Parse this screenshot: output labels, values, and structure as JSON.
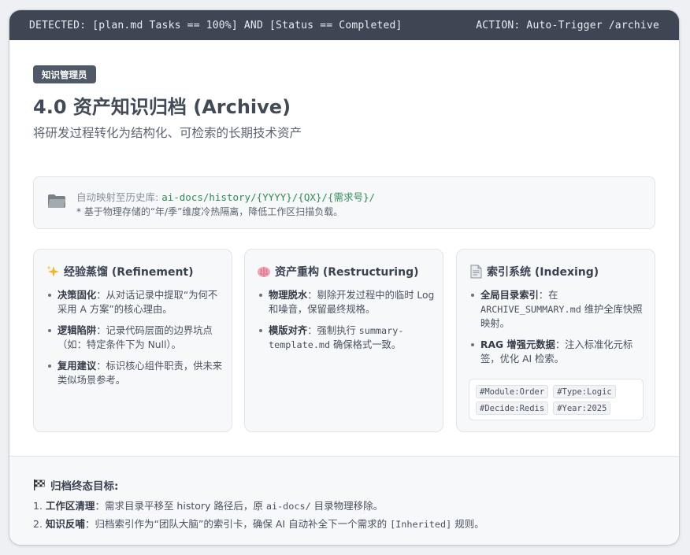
{
  "topbar": {
    "detected": "DETECTED: [plan.md Tasks == 100%] AND [Status == Completed]",
    "action": "ACTION: Auto-Trigger /archive"
  },
  "header": {
    "badge": "知识管理员",
    "title": "4.0 资产知识归档 (Archive)",
    "subtitle": "将研发过程转化为结构化、可检索的长期技术资产"
  },
  "mapping": {
    "icon": "folder-icon",
    "label": "自动映射至历史库:",
    "path": "ai-docs/history/{YYYY}/{QX}/{需求号}/",
    "note": "* 基于物理存储的“年/季”维度冷热隔离，降低工作区扫描负载。"
  },
  "columns": [
    {
      "icon": "sparkles-icon",
      "title": "经验蒸馏 (Refinement)",
      "items": [
        {
          "bold": "决策固化",
          "sep": "：",
          "text": "从对话记录中提取“为何不采用 A 方案”的核心理由。"
        },
        {
          "bold": "逻辑陷阱",
          "sep": "：",
          "text": "记录代码层面的边界坑点（如：特定条件下为 Null）。"
        },
        {
          "bold": "复用建议",
          "sep": "：",
          "text": "标识核心组件职责，供未来类似场景参考。"
        }
      ]
    },
    {
      "icon": "brain-icon",
      "title": "资产重构 (Restructuring)",
      "items": [
        {
          "bold": "物理脱水",
          "sep": "：",
          "text": "剔除开发过程中的临时 Log 和噪音，保留最终规格。"
        },
        {
          "bold": "模版对齐",
          "sep": "：",
          "text_pre": "强制执行 ",
          "code": "summary-template.md",
          "text_post": " 确保格式一致。"
        }
      ]
    },
    {
      "icon": "document-icon",
      "title": "索引系统 (Indexing)",
      "items": [
        {
          "bold": "全局目录索引",
          "sep": "：",
          "text_pre": "在 ",
          "code": "ARCHIVE_SUMMARY.md",
          "text_post": " 维护全库快照映射。"
        },
        {
          "bold": "RAG 增强元数据",
          "sep": "：",
          "text": "注入标准化元标签，优化 AI 检索。"
        }
      ],
      "tags": [
        "#Module:Order",
        "#Type:Logic",
        "#Decide:Redis",
        "#Year:2025"
      ]
    }
  ],
  "footer": {
    "icon": "checkered-flag-icon",
    "title": "归档终态目标:",
    "goals": [
      {
        "num": "1.",
        "bold": "工作区清理",
        "sep": "：",
        "text_pre": "需求目录平移至 history 路径后，原 ",
        "code": "ai-docs/",
        "text_post": " 目录物理移除。"
      },
      {
        "num": "2.",
        "bold": "知识反哺",
        "sep": "：",
        "text_pre": "归档索引作为“团队大脑”的索引卡，确保 AI 自动补全下一个需求的 ",
        "code": "[Inherited]",
        "text_post": " 规则。"
      }
    ]
  }
}
